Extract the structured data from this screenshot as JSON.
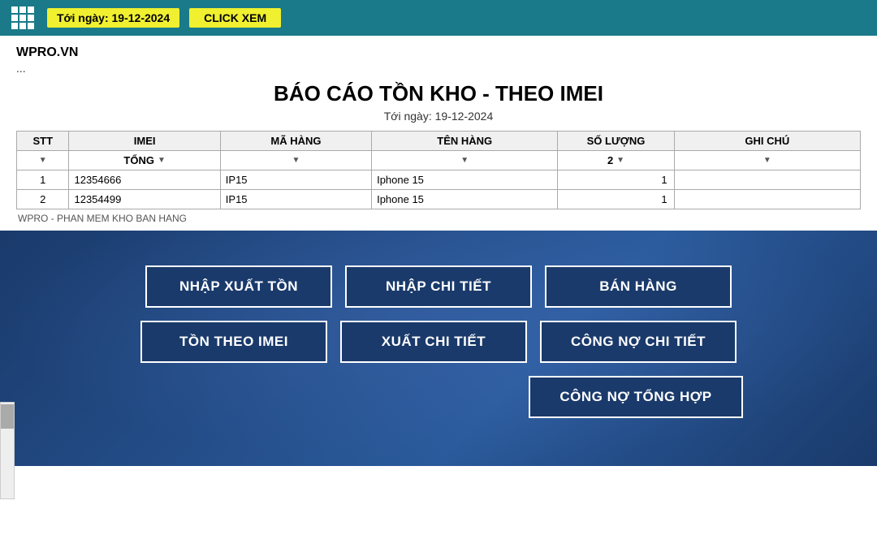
{
  "topbar": {
    "date_label": "Tới ngày: 19-12-2024",
    "click_xem": "CLICK XEM"
  },
  "header": {
    "site_title": "WPRO.VN",
    "ellipsis": "...",
    "report_title": "BÁO CÁO TỒN KHO - THEO IMEI",
    "report_date": "Tới ngày: 19-12-2024"
  },
  "table": {
    "columns": [
      "STT",
      "IMEI",
      "MÃ HÀNG",
      "TÊN HÀNG",
      "SỐ LƯỢNG",
      "GHI CHÚ"
    ],
    "summary_row": {
      "label": "TỔNG",
      "so_luong": "2"
    },
    "rows": [
      {
        "stt": "1",
        "imei": "12354666",
        "ma_hang": "IP15",
        "ten_hang": "Iphone 15",
        "so_luong": "1",
        "ghi_chu": ""
      },
      {
        "stt": "2",
        "imei": "12354499",
        "ma_hang": "IP15",
        "ten_hang": "Iphone 15",
        "so_luong": "1",
        "ghi_chu": ""
      }
    ]
  },
  "footer": {
    "label": "WPRO - PHAN MEM KHO BAN HANG"
  },
  "nav_buttons": [
    {
      "id": "nhap-xuat-ton",
      "label": "NHẬP XUẤT TỒN"
    },
    {
      "id": "nhap-chi-tiet",
      "label": "NHẬP CHI TIẾT"
    },
    {
      "id": "ban-hang",
      "label": "BÁN HÀNG"
    },
    {
      "id": "ton-theo-imei",
      "label": "TỒN THEO IMEI"
    },
    {
      "id": "xuat-chi-tiet",
      "label": "XUẤT CHI TIẾT"
    },
    {
      "id": "cong-no-chi-tiet",
      "label": "CÔNG NỢ CHI TIẾT"
    },
    {
      "id": "cong-no-tong-hop",
      "label": "CÔNG NỢ TỔNG HỢP"
    }
  ]
}
